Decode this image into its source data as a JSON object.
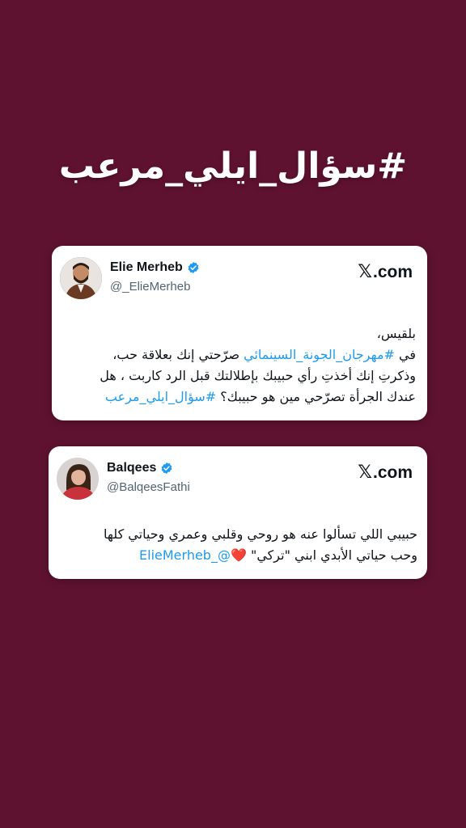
{
  "headline": "#سؤال_ايلي_مرعب",
  "tweets": [
    {
      "name": "Elie Merheb",
      "handle": "@_ElieMerheb",
      "site": "com",
      "text": {
        "line1": "بلقيس،",
        "line2_pre": "في ",
        "line2_link": "#مهرجان_الجونة_السينمائي",
        "line2_post": " صرّحتي إنك بعلاقة حب،",
        "line3": "وذكرتِ إنك أخذتِ رأي حبيبك بإطلالتك قبل الرد كاربت ، هل",
        "line4_pre": "عندك الجرأة تصرّحي مين هو حبيبك؟ ",
        "line4_link": "#سؤال_ايلي_مرعب"
      }
    },
    {
      "name": "Balqees",
      "handle": "@BalqeesFathi",
      "site": "com",
      "text": {
        "line1": "حبيبي اللي تسألوا عنه هو روحي وقلبي وعمري وحياتي كلها",
        "line2_pre": "وحب حياتي الأبدي  ابني \"تركي\" ",
        "line2_heart": "❤️",
        "line2_link": "@_ElieMerheb"
      }
    }
  ],
  "colors": {
    "background": "#5e1230",
    "link": "#1d9bf0",
    "verified": "#1d9bf0"
  }
}
